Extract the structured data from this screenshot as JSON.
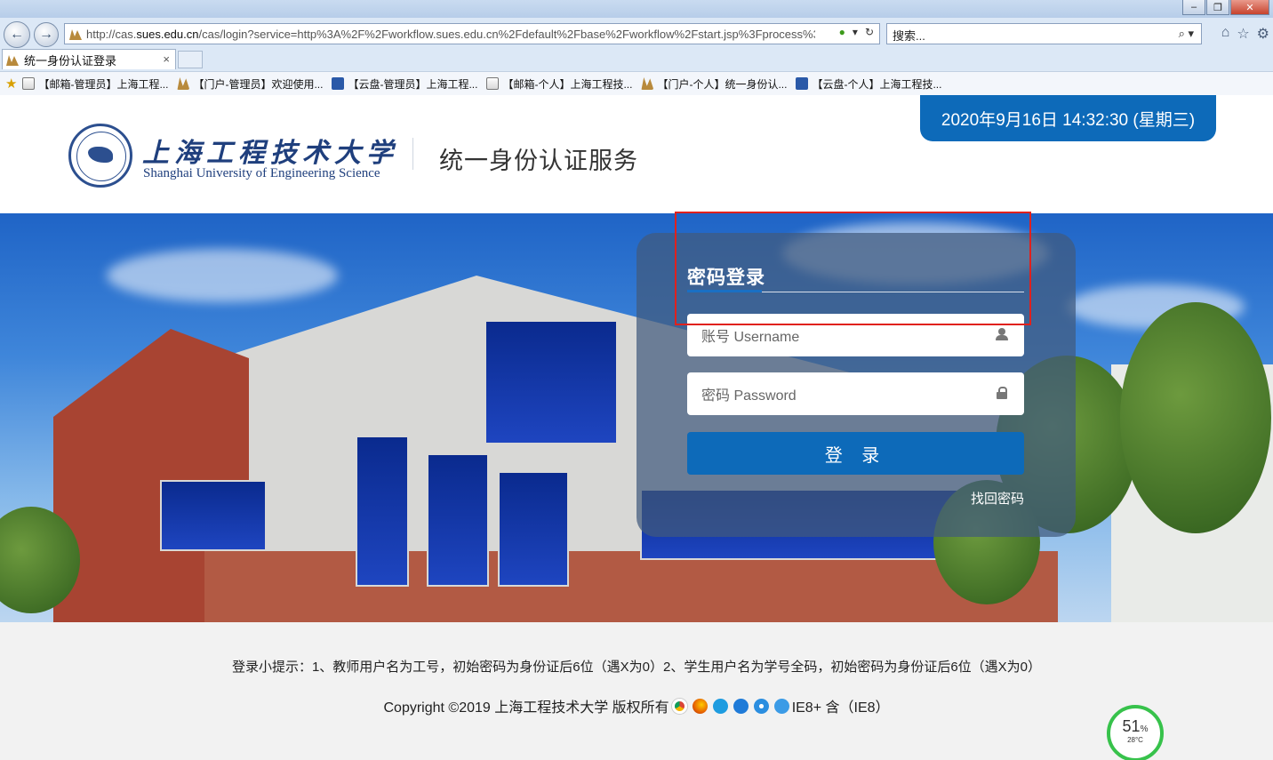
{
  "browser": {
    "url_prefix": "http://cas.",
    "url_domain": "sues.edu.cn",
    "url_rest": "/cas/login?service=http%3A%2F%2Fworkflow.sues.edu.cn%2Fdefault%2Fbase%2Fworkflow%2Fstart.jsp%3Fprocess%3Dcom",
    "search_placeholder": "搜索...",
    "tab_title": "统一身份认证登录",
    "tab_close": "×",
    "favorites": [
      {
        "label": "【邮箱-管理员】上海工程...",
        "icon": "mail-icon"
      },
      {
        "label": "【门户-管理员】欢迎使用...",
        "icon": "portal-icon"
      },
      {
        "label": "【云盘-管理员】上海工程...",
        "icon": "cloud-icon"
      },
      {
        "label": "【邮箱-个人】上海工程技...",
        "icon": "mail-icon"
      },
      {
        "label": "【门户-个人】统一身份认...",
        "icon": "portal-icon"
      },
      {
        "label": "【云盘-个人】上海工程技...",
        "icon": "cloud-icon"
      }
    ]
  },
  "header": {
    "logo_cn": "上海工程技术大学",
    "logo_en": "Shanghai University of Engineering Science",
    "service_title": "统一身份认证服务",
    "datetime": "2020年9月16日 14:32:30 (星期三)"
  },
  "login": {
    "title": "密码登录",
    "username_placeholder": "账号 Username",
    "password_placeholder": "密码 Password",
    "submit_label": "登 录",
    "forgot_label": "找回密码"
  },
  "footer": {
    "tip": "登录小提示：1、教师用户名为工号，初始密码为身份证后6位（遇X为0）2、学生用户名为学号全码，初始密码为身份证后6位（遇X为0）",
    "copyright": "Copyright ©2019 上海工程技术大学 版权所有",
    "browser_support": "IE8+ 含（IE8）"
  },
  "widget": {
    "percent": "51",
    "percent_unit": "%",
    "temp": "28°C"
  },
  "colors": {
    "brand_blue": "#0d6ab9",
    "highlight_red": "#e0211d",
    "widget_green": "#37c24b"
  }
}
